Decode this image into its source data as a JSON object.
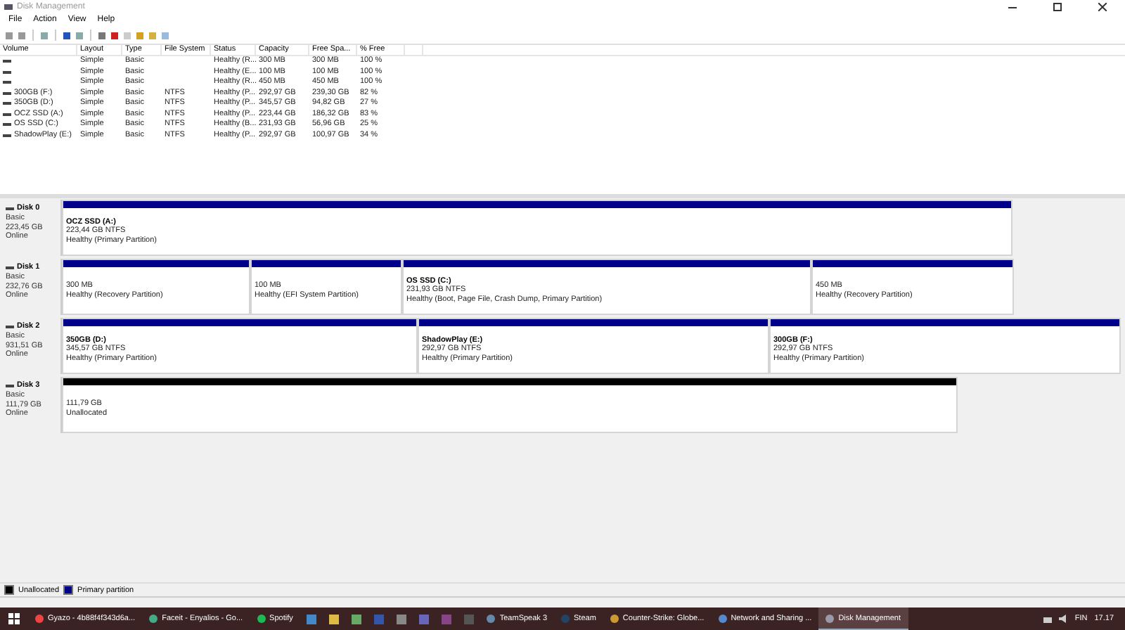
{
  "window": {
    "title": "Disk Management"
  },
  "menu": [
    "File",
    "Action",
    "View",
    "Help"
  ],
  "table": {
    "columns": [
      "Volume",
      "Layout",
      "Type",
      "File System",
      "Status",
      "Capacity",
      "Free Spa...",
      "% Free"
    ],
    "rows": [
      [
        "",
        "Simple",
        "Basic",
        "",
        "Healthy (R...",
        "300 MB",
        "300 MB",
        "100 %"
      ],
      [
        "",
        "Simple",
        "Basic",
        "",
        "Healthy (E...",
        "100 MB",
        "100 MB",
        "100 %"
      ],
      [
        "",
        "Simple",
        "Basic",
        "",
        "Healthy (R...",
        "450 MB",
        "450 MB",
        "100 %"
      ],
      [
        "300GB (F:)",
        "Simple",
        "Basic",
        "NTFS",
        "Healthy (P...",
        "292,97 GB",
        "239,30 GB",
        "82 %"
      ],
      [
        "350GB (D:)",
        "Simple",
        "Basic",
        "NTFS",
        "Healthy (P...",
        "345,57 GB",
        "94,82 GB",
        "27 %"
      ],
      [
        "OCZ SSD (A:)",
        "Simple",
        "Basic",
        "NTFS",
        "Healthy (P...",
        "223,44 GB",
        "186,32 GB",
        "83 %"
      ],
      [
        "OS SSD (C:)",
        "Simple",
        "Basic",
        "NTFS",
        "Healthy (B...",
        "231,93 GB",
        "56,96 GB",
        "25 %"
      ],
      [
        "ShadowPlay (E:)",
        "Simple",
        "Basic",
        "NTFS",
        "Healthy (P...",
        "292,97 GB",
        "100,97 GB",
        "34 %"
      ]
    ]
  },
  "disks": [
    {
      "name": "Disk 0",
      "type": "Basic",
      "size": "223,45 GB",
      "status": "Online",
      "partitions": [
        {
          "kind": "primary",
          "title": "OCZ SSD  (A:)",
          "size": "223,44 GB NTFS",
          "status": "Healthy (Primary Partition)"
        }
      ]
    },
    {
      "name": "Disk 1",
      "type": "Basic",
      "size": "232,76 GB",
      "status": "Online",
      "partitions": [
        {
          "kind": "primary",
          "size": "300 MB",
          "status": "Healthy (Recovery Partition)"
        },
        {
          "kind": "primary",
          "size": "100 MB",
          "status": "Healthy (EFI System Partition)"
        },
        {
          "kind": "primary",
          "title": "OS SSD  (C:)",
          "size": "231,93 GB NTFS",
          "status": "Healthy (Boot, Page File, Crash Dump, Primary Partition)"
        },
        {
          "kind": "primary",
          "size": "450 MB",
          "status": "Healthy (Recovery Partition)"
        }
      ]
    },
    {
      "name": "Disk 2",
      "type": "Basic",
      "size": "931,51 GB",
      "status": "Online",
      "partitions": [
        {
          "kind": "primary",
          "title": "350GB  (D:)",
          "size": "345,57 GB NTFS",
          "status": "Healthy (Primary Partition)"
        },
        {
          "kind": "primary",
          "title": "ShadowPlay  (E:)",
          "size": "292,97 GB NTFS",
          "status": "Healthy (Primary Partition)"
        },
        {
          "kind": "primary",
          "title": "300GB  (F:)",
          "size": "292,97 GB NTFS",
          "status": "Healthy (Primary Partition)"
        }
      ]
    },
    {
      "name": "Disk 3",
      "type": "Basic",
      "size": "111,79 GB",
      "status": "Online",
      "partitions": [
        {
          "kind": "unallocated",
          "size": "111,79 GB",
          "status": "Unallocated"
        }
      ]
    }
  ],
  "legend": [
    {
      "kind": "unallocated",
      "label": "Unallocated"
    },
    {
      "kind": "primary",
      "label": "Primary partition"
    }
  ],
  "taskbar": {
    "apps": [
      {
        "label": "Gyazo - 4b88f4f343d6a...",
        "selected": false
      },
      {
        "label": "Faceit - Enyalios - Go...",
        "selected": false
      },
      {
        "label": "Spotify",
        "selected": false
      },
      {
        "label": "TeamSpeak 3",
        "selected": false
      },
      {
        "label": "Steam",
        "selected": false
      },
      {
        "label": "Counter-Strike: Globe...",
        "selected": false
      },
      {
        "label": "Network and Sharing ...",
        "selected": false
      },
      {
        "label": "Disk Management",
        "selected": true
      }
    ],
    "language": "FIN",
    "clock": "17.17"
  }
}
